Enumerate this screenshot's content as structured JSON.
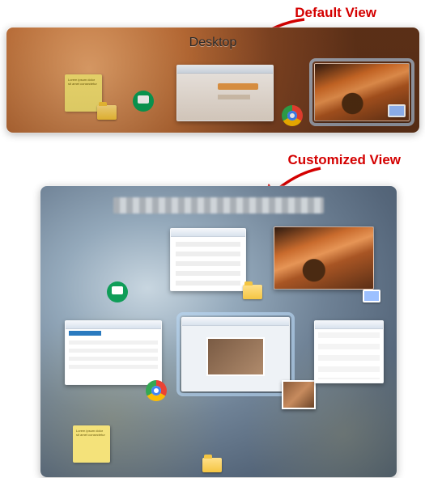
{
  "annotations": {
    "default_label": "Default View",
    "customized_label": "Customized View"
  },
  "default_view": {
    "title": "Desktop",
    "sticky_text": "Lorem ipsum dolor sit amet consectetur"
  },
  "custom_view": {
    "title_obscured": true
  }
}
